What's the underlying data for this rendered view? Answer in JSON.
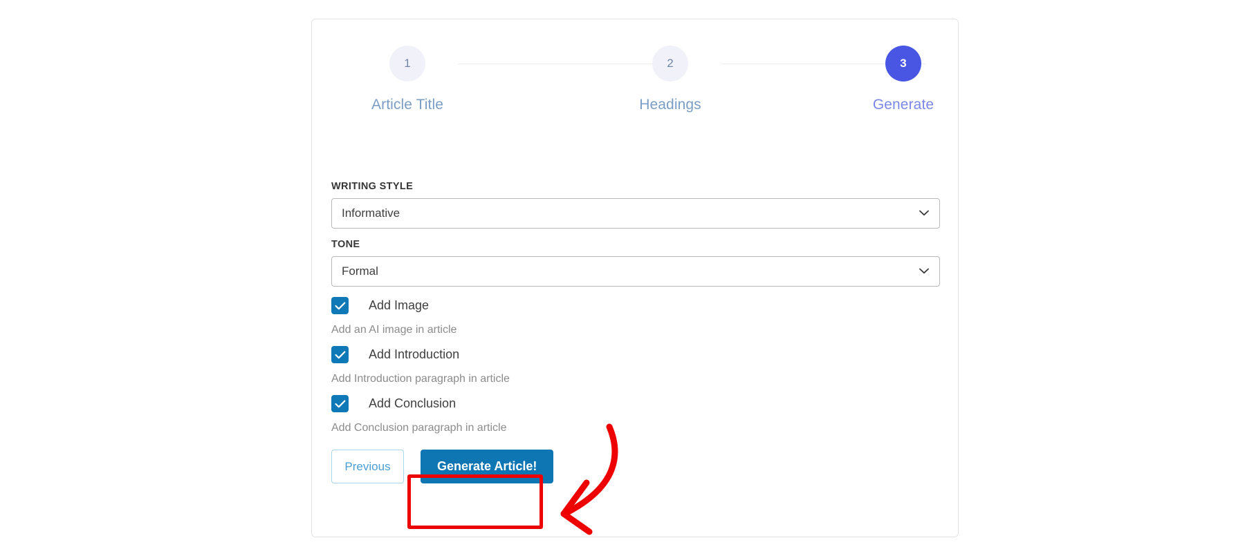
{
  "wizard": {
    "steps": [
      {
        "number": "1",
        "label": "Article Title",
        "state": "inactive"
      },
      {
        "number": "2",
        "label": "Headings",
        "state": "inactive"
      },
      {
        "number": "3",
        "label": "Generate",
        "state": "active"
      }
    ]
  },
  "form": {
    "writing_style": {
      "label": "WRITING STYLE",
      "value": "Informative"
    },
    "tone": {
      "label": "TONE",
      "value": "Formal"
    },
    "options": [
      {
        "label": "Add Image",
        "helper": "Add an AI image in article",
        "checked": "true"
      },
      {
        "label": "Add Introduction",
        "helper": "Add Introduction paragraph in article",
        "checked": "true"
      },
      {
        "label": "Add Conclusion",
        "helper": "Add Conclusion paragraph in article",
        "checked": "true"
      }
    ]
  },
  "buttons": {
    "previous": "Previous",
    "generate": "Generate Article!"
  },
  "colors": {
    "accent_blue": "#0f76b4",
    "step_active": "#4956e3",
    "step_inactive_bg": "#f1f1f9",
    "checkbox_blue": "#0f78b6",
    "annotation_red": "#ee0000",
    "step_label": "#7a9dc6"
  }
}
